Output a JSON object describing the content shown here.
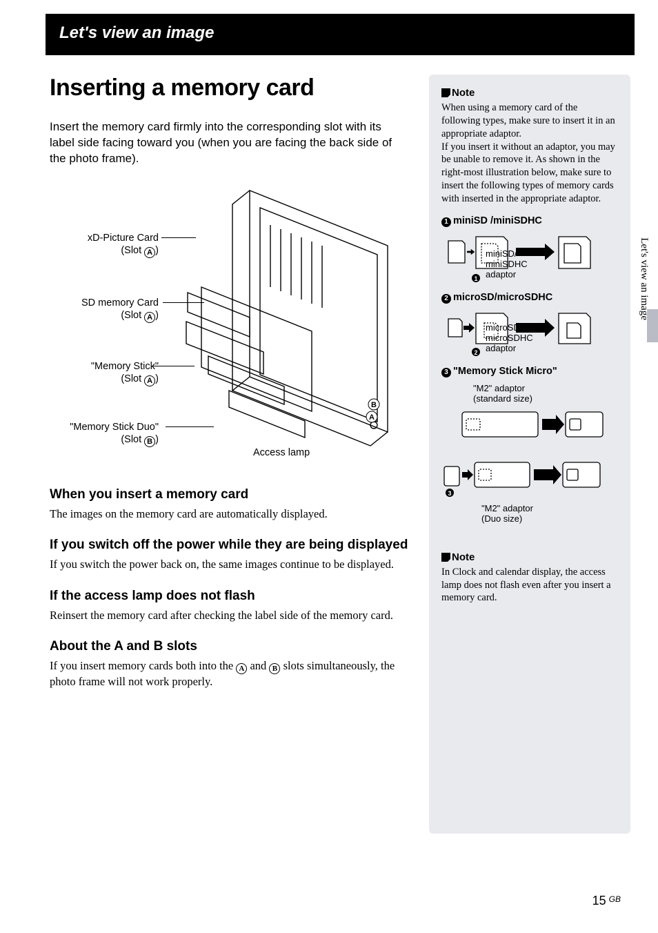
{
  "chapterTitle": "Let's view an image",
  "mainHeading": "Inserting a memory card",
  "introText": "Insert the memory card firmly into the corresponding slot with its label side facing toward you (when you are facing the back side of the photo frame).",
  "diagram": {
    "labels": {
      "xd": {
        "line1": "xD-Picture Card",
        "line2_prefix": "(Slot ",
        "slot": "A",
        "line2_suffix": ")"
      },
      "sd": {
        "line1": "SD memory Card",
        "line2_prefix": "(Slot ",
        "slot": "A",
        "line2_suffix": ")"
      },
      "ms": {
        "line1": "\"Memory Stick\"",
        "line2_prefix": "(Slot ",
        "slot": "A",
        "line2_suffix": ")"
      },
      "msduo": {
        "line1": "\"Memory Stick Duo\"",
        "line2_prefix": "(Slot ",
        "slot": "B",
        "line2_suffix": ")"
      }
    },
    "accessLamp": "Access lamp",
    "markerA": "A",
    "markerB": "B"
  },
  "sections": [
    {
      "heading": "When you insert a memory card",
      "body": "The images on the memory card are automatically displayed."
    },
    {
      "heading": "If you switch off the power while they are being displayed",
      "body": "If you switch the power back on, the same images continue to be displayed."
    },
    {
      "heading": "If the access lamp does not flash",
      "body": "Reinsert the memory card after checking the label side of the memory card."
    },
    {
      "heading": "About the A and B slots",
      "body_parts": [
        "If you insert memory cards both into the ",
        " and ",
        " slots simultaneously, the photo frame will not work properly."
      ],
      "slotA": "A",
      "slotB": "B"
    }
  ],
  "sidebar": {
    "note1": {
      "title": "Note",
      "body": "When using a memory card of the following types, make sure to insert it in an appropriate adaptor.\nIf you insert it without an adaptor, you may be unable to remove it. As shown in the right-most illustration below, make sure to insert the following types of memory cards with inserted in the appropriate adaptor."
    },
    "adaptors": [
      {
        "num": "1",
        "title": "miniSD /miniSDHC",
        "caption": "miniSD/\nminiSDHC\nadaptor",
        "capNum": "1"
      },
      {
        "num": "2",
        "title": "microSD/microSDHC",
        "caption": "microSD/\nmicroSDHC\nadaptor",
        "capNum": "2"
      },
      {
        "num": "3",
        "title": "\"Memory Stick Micro\"",
        "caption1": "\"M2\" adaptor\n(standard size)",
        "caption2": "\"M2\" adaptor\n(Duo size)",
        "capNum": "3"
      }
    ],
    "note2": {
      "title": "Note",
      "body": "In Clock and calendar display, the access lamp does not flash even after you insert a memory card."
    },
    "tabText": "Let's view an image"
  },
  "pageNumber": "15",
  "pageRegion": "GB"
}
